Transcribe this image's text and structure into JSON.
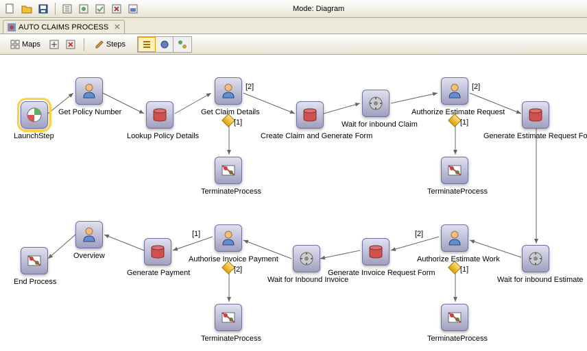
{
  "mode": "Mode: Diagram",
  "tab": {
    "title": "AUTO CLAIMS PROCESS"
  },
  "toolbar2": {
    "maps": "Maps",
    "steps": "Steps"
  },
  "nodes": {
    "launchStep": "LaunchStep",
    "getPolicyNumber": "Get Policy Number",
    "lookupPolicyDetails": "Lookup Policy Details",
    "getClaimDetails": "Get Claim Details",
    "terminateProcess1": "TerminateProcess",
    "createClaimGenerateForm": "Create Claim and Generate Form",
    "waitInboundClaim": "Wait for inbound Claim",
    "authorizeEstimateRequest": "Authorize Estimate Request",
    "terminateProcess2": "TerminateProcess",
    "generateEstimateRequestForm": "Generate Estimate Request Form",
    "waitInboundEstimate": "Wait for inbound Estimate",
    "authorizeEstimateWork": "Authorize Estimate Work",
    "terminateProcess3": "TerminateProcess",
    "generateInvoiceRequestForm": "Generate Invoice Request Form",
    "waitInboundInvoice": "Wait for Inbound Invoice",
    "authoriseInvoicePayment": "Authorise Invoice Payment",
    "terminateProcess4": "TerminateProcess",
    "generatePayment": "Generate Payment",
    "overview": "Overview",
    "endProcess": "End Process"
  },
  "branches": {
    "b1": "[1]",
    "b2": "[2]"
  }
}
